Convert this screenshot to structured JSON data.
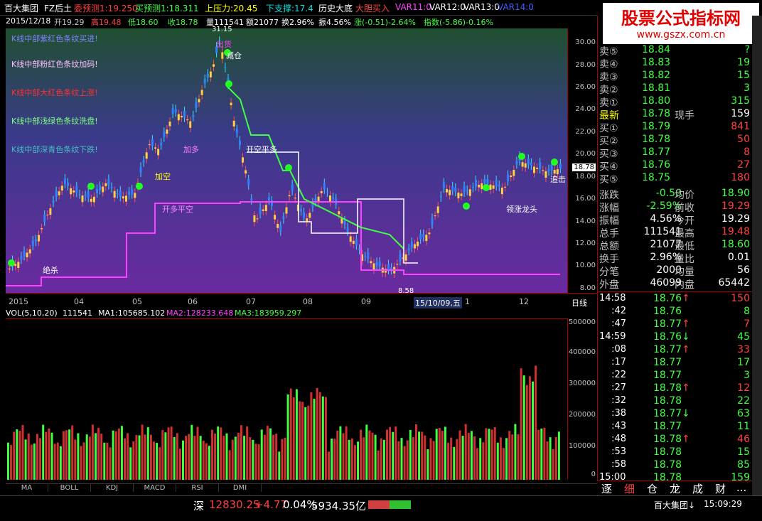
{
  "title": {
    "name": "百大集团",
    "formula": "FZ后土",
    "v1": "委预测1:19.250",
    "v2": "买预测1:18.311",
    "v3": "上压力:20.45",
    "v4": "下支撑:17.4",
    "v5": "历史大底",
    "v6": "大胆买入",
    "v7": "VAR11:0",
    "v8": "VAR12:0",
    "v9": "VAR13:0",
    "v10": "VAR14:0"
  },
  "info": {
    "date": "2015/12/18",
    "open": "开19.29",
    "high": "高19.48",
    "low": "低18.60",
    "close": "收18.78",
    "vol": "量111541",
    "amt": "额21077",
    "turn": "换2.96%",
    "amp": "振4.56%",
    "chg": "涨(-0.51)-2.64%",
    "idx": "指数(-5.86)-0.16%"
  },
  "legend": {
    "l1": "K线中部紫红色条纹买进!",
    "l2": "K线中部粉红色条纹加码!",
    "l3": "K线中部大红色条纹上涨!",
    "l4": "K线中部浅绿色条纹洗盘!",
    "l5": "K线中部深青色条纹下跌!"
  },
  "price_ticks": [
    "30.00",
    "28.00",
    "26.00",
    "24.00",
    "22.00",
    "20.00",
    "18.00",
    "16.00",
    "14.00",
    "12.00",
    "10.00",
    "8.00"
  ],
  "current_price": "18.78",
  "date_ticks": [
    "2015",
    "04",
    "05",
    "06",
    "07",
    "08",
    "09",
    "15/10/09,五",
    "1",
    "12"
  ],
  "period": "日线",
  "vol_title": {
    "t": "VOL(5,10,20)",
    "v": "111541",
    "ma1": "MA1:105685.102",
    "ma2": "MA2:128233.648",
    "ma3": "MA3:183959.297"
  },
  "vol_ticks": [
    "500000",
    "400000",
    "300000",
    "200000",
    "100000",
    "0"
  ],
  "tabs": [
    "MA",
    "BOLL",
    "KDJ",
    "MACD",
    "RSI",
    "DMI"
  ],
  "chart_labels": {
    "a": "减仓",
    "b": "绝杀",
    "c": "出货",
    "d": "加多",
    "e": "开空平多",
    "f": "追击",
    "g": "开多平空",
    "h": "加空",
    "i": "8.58",
    "j": "31.15",
    "k": "领涨龙头"
  },
  "orderbook": [
    {
      "l": "卖⑤",
      "p": "18.84",
      "v": "?"
    },
    {
      "l": "卖④",
      "p": "18.83",
      "v": "19"
    },
    {
      "l": "卖③",
      "p": "18.82",
      "v": "15"
    },
    {
      "l": "卖②",
      "p": "18.81",
      "v": "3"
    },
    {
      "l": "卖①",
      "p": "18.80",
      "v": "315"
    },
    {
      "l": "最新",
      "p": "18.78",
      "l2": "现手",
      "v": "159"
    },
    {
      "l": "买①",
      "p": "18.79",
      "v": "841"
    },
    {
      "l": "买②",
      "p": "18.78",
      "v": "50"
    },
    {
      "l": "买③",
      "p": "18.77",
      "v": "8"
    },
    {
      "l": "买④",
      "p": "18.76",
      "v": "27"
    },
    {
      "l": "买⑤",
      "p": "18.75",
      "v": "180"
    }
  ],
  "stats": [
    {
      "l": "涨跌",
      "a": "-0.50",
      "l2": "均价",
      "b": "18.90"
    },
    {
      "l": "涨幅",
      "a": "-2.59%",
      "l2": "前收",
      "b": "19.29"
    },
    {
      "l": "振幅",
      "a": "4.56%",
      "l2": "今开",
      "b": "19.29"
    },
    {
      "l": "总手",
      "a": "111541",
      "l2": "最高",
      "b": "19.48"
    },
    {
      "l": "总额",
      "a": "21077",
      "l2": "最低",
      "b": "18.60"
    },
    {
      "l": "换手",
      "a": "2.96%",
      "l2": "量比",
      "b": "0.01"
    },
    {
      "l": "分笔",
      "a": "2000",
      "l2": "均量",
      "b": "56"
    },
    {
      "l": "外盘",
      "a": "46099",
      "l2": "内盘",
      "b": "65442"
    }
  ],
  "ticks": [
    {
      "t": "14:58",
      "p": "18.76",
      "d": "↑",
      "v": "150"
    },
    {
      "t": ":42",
      "p": "18.76",
      "d": "",
      "v": "8"
    },
    {
      "t": ":47",
      "p": "18.77",
      "d": "↑",
      "v": "7"
    },
    {
      "t": "14:59",
      "p": "18.76",
      "d": "↓",
      "v": "45"
    },
    {
      "t": ":08",
      "p": "18.77",
      "d": "↑",
      "v": "33"
    },
    {
      "t": ":17",
      "p": "18.77",
      "d": "",
      "v": "17"
    },
    {
      "t": ":22",
      "p": "18.77",
      "d": "",
      "v": "3"
    },
    {
      "t": ":27",
      "p": "18.78",
      "d": "↑",
      "v": "12"
    },
    {
      "t": ":32",
      "p": "18.78",
      "d": "",
      "v": "22"
    },
    {
      "t": ":38",
      "p": "18.77",
      "d": "↓",
      "v": "63"
    },
    {
      "t": ":43",
      "p": "18.77",
      "d": "",
      "v": "11"
    },
    {
      "t": ":48",
      "p": "18.78",
      "d": "↑",
      "v": "46"
    },
    {
      "t": ":53",
      "p": "18.78",
      "d": "",
      "v": "15"
    },
    {
      "t": ":58",
      "p": "18.78",
      "d": "",
      "v": "85"
    },
    {
      "t": "15:00",
      "p": "18.78",
      "d": "",
      "v": "159"
    }
  ],
  "right_tabs": [
    "逐",
    "细",
    "仓",
    "龙",
    "成",
    "财",
    "..."
  ],
  "status": {
    "market": "深",
    "index": "12830.25",
    "chg": "+4.77",
    "pct": "0.04%",
    "amt": "5934.35亿",
    "stock": "百大集团↓",
    "time": "15:09:29"
  },
  "watermark": {
    "line1": "股票公式指标网",
    "line2": "www.gszx.com.cn"
  },
  "chart_data": {
    "type": "bar",
    "title": "VOL(5,10,20)",
    "ylim": [
      0,
      500000
    ],
    "note_values": [
      111541
    ]
  }
}
